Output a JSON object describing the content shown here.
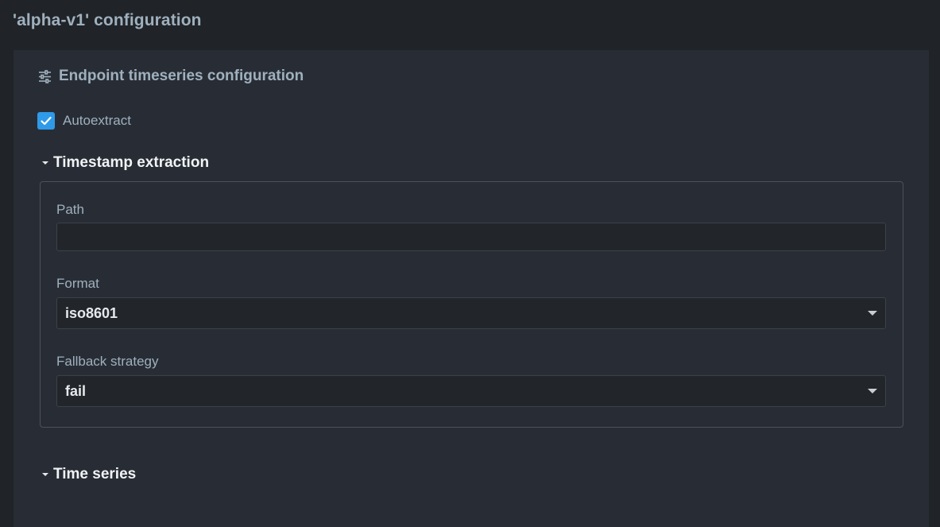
{
  "page": {
    "title": "'alpha-v1' configuration"
  },
  "section": {
    "icon": "sliders-icon",
    "title": "Endpoint timeseries configuration"
  },
  "autoextract": {
    "label": "Autoextract",
    "checked": true
  },
  "timestamp_extraction": {
    "title": "Timestamp extraction",
    "expanded": true,
    "path": {
      "label": "Path",
      "value": ""
    },
    "format": {
      "label": "Format",
      "value": "iso8601"
    },
    "fallback": {
      "label": "Fallback strategy",
      "value": "fail"
    }
  },
  "time_series": {
    "title": "Time series",
    "expanded": true
  },
  "colors": {
    "background": "#202327",
    "panel": "#282d35",
    "accent": "#2f9ae8",
    "muted_text": "#9fb0be",
    "bright_text": "#f1f3f5"
  }
}
